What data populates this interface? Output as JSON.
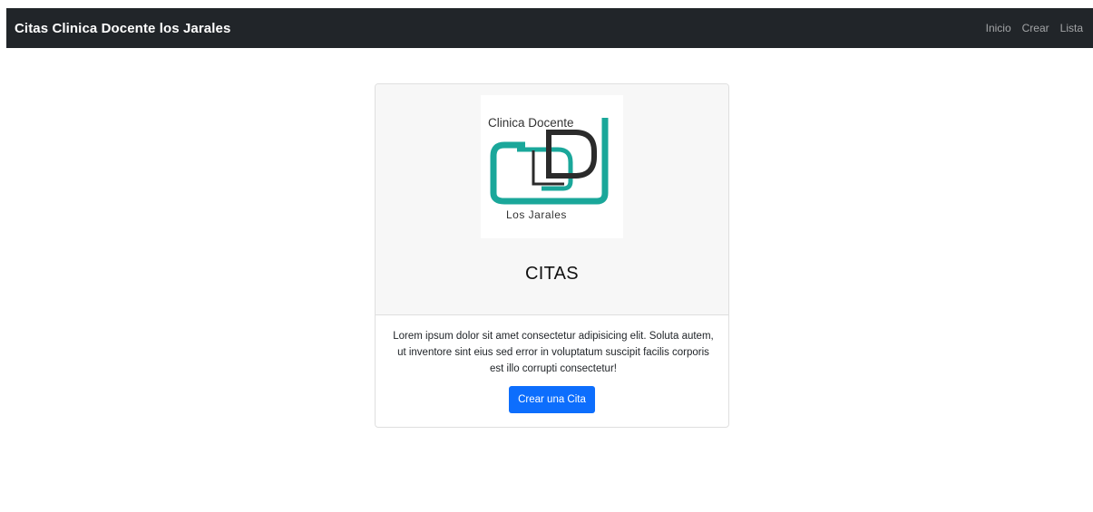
{
  "navbar": {
    "brand": "Citas Clinica Docente los Jarales",
    "links": [
      "Inicio",
      "Crear",
      "Lista"
    ]
  },
  "card": {
    "logo": {
      "top_text": "Clinica Docente",
      "bottom_text": "Los Jarales",
      "accent_color": "#1aa79a",
      "dark_color": "#2b2b2b"
    },
    "title": "CITAS",
    "text": "Lorem ipsum dolor sit amet consectetur adipisicing elit. Soluta autem, ut inventore sint eius sed error in voluptatum suscipit facilis corporis est illo corrupti consectetur!",
    "button_label": "Crear una Cita"
  },
  "colors": {
    "navbar_bg": "#212529",
    "primary": "#0d6efd",
    "card_header_bg": "#f7f7f7"
  }
}
